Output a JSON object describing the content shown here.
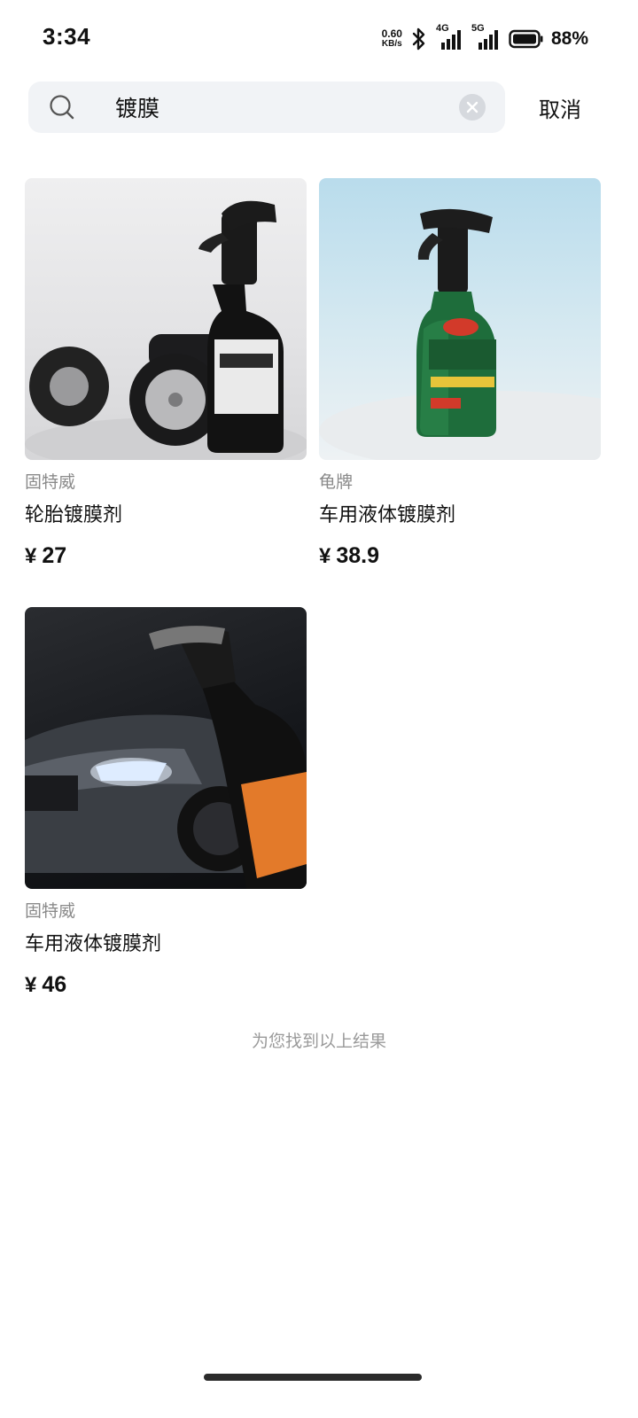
{
  "status_bar": {
    "time": "3:34",
    "net_speed_value": "0.60",
    "net_speed_unit": "KB/s",
    "signal1_label": "4G",
    "signal2_label": "5G",
    "battery_percent": "88%",
    "icons": [
      "bluetooth-icon",
      "signal-4g-icon",
      "signal-5g-icon",
      "battery-icon"
    ]
  },
  "search": {
    "query": "镀膜",
    "cancel_label": "取消"
  },
  "products": [
    {
      "brand": "固特威",
      "title": "轮胎镀膜剂",
      "currency": "¥",
      "price": "27"
    },
    {
      "brand": "龟牌",
      "title": "车用液体镀膜剂",
      "currency": "¥",
      "price": "38.9"
    },
    {
      "brand": "固特威",
      "title": "车用液体镀膜剂",
      "currency": "¥",
      "price": "46"
    }
  ],
  "footer_note": "为您找到以上结果",
  "colors": {
    "search_bg": "#f1f3f6",
    "muted_text": "#8a8a8a",
    "text": "#111111"
  }
}
